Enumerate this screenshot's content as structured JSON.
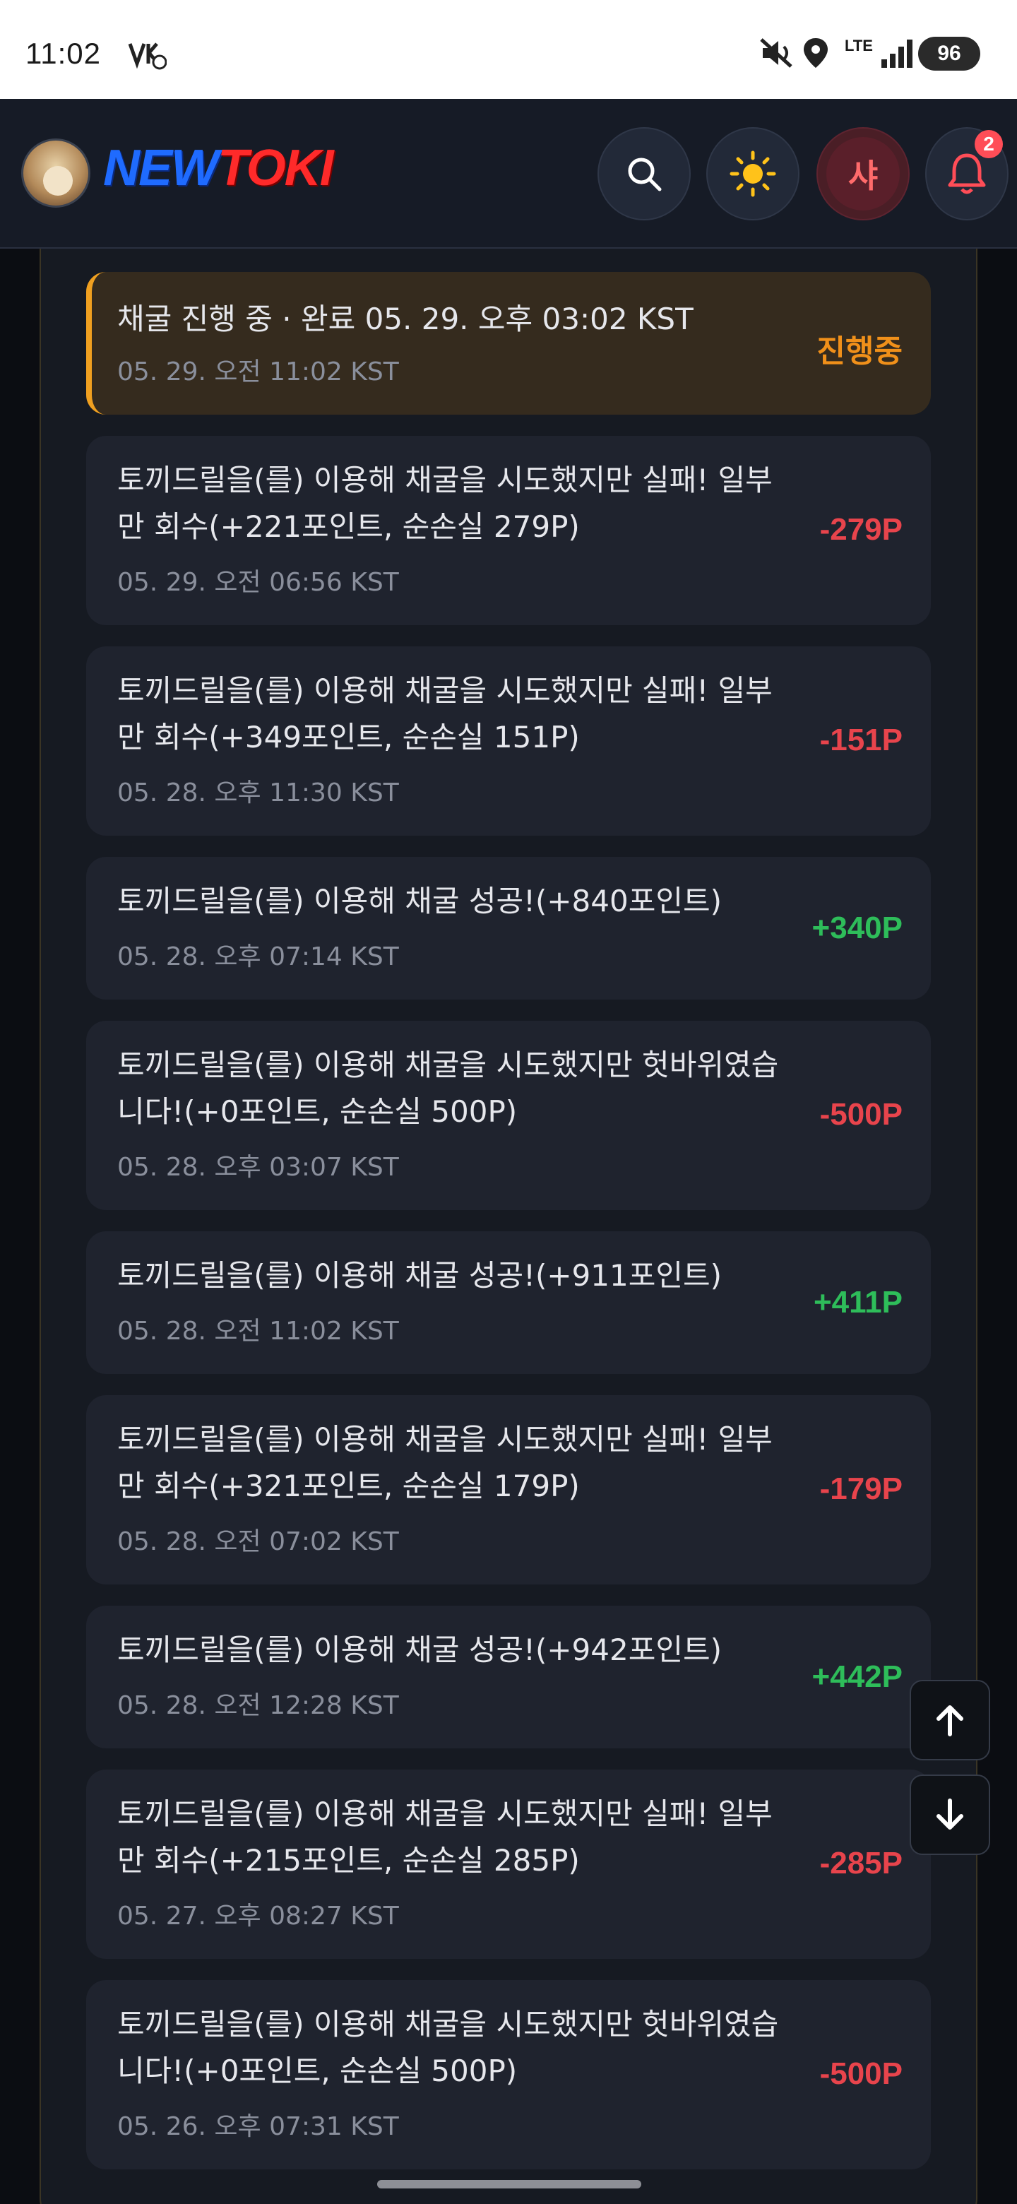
{
  "status_bar": {
    "time": "11:02",
    "network": "LTE",
    "battery": "96"
  },
  "header": {
    "logo_new": "NEW",
    "logo_toki": "TOKI",
    "user_initial": "샤",
    "notification_count": "2"
  },
  "entries": [
    {
      "message": "채굴 진행 중 · 완료 05. 29. 오후 03:02 KST",
      "date": "05. 29. 오전 11:02 KST",
      "amount": "진행중",
      "type": "pending"
    },
    {
      "message": "토끼드릴을(를) 이용해 채굴을 시도했지만 실패! 일부만 회수(+221포인트, 순손실 279P)",
      "date": "05. 29. 오전 06:56 KST",
      "amount": "-279P",
      "type": "negative"
    },
    {
      "message": "토끼드릴을(를) 이용해 채굴을 시도했지만 실패! 일부만 회수(+349포인트, 순손실 151P)",
      "date": "05. 28. 오후 11:30 KST",
      "amount": "-151P",
      "type": "negative"
    },
    {
      "message": "토끼드릴을(를) 이용해 채굴 성공!(+840포인트)",
      "date": "05. 28. 오후 07:14 KST",
      "amount": "+340P",
      "type": "positive"
    },
    {
      "message": "토끼드릴을(를) 이용해 채굴을 시도했지만 헛바위였습니다!(+0포인트, 순손실 500P)",
      "date": "05. 28. 오후 03:07 KST",
      "amount": "-500P",
      "type": "negative"
    },
    {
      "message": "토끼드릴을(를) 이용해 채굴 성공!(+911포인트)",
      "date": "05. 28. 오전 11:02 KST",
      "amount": "+411P",
      "type": "positive"
    },
    {
      "message": "토끼드릴을(를) 이용해 채굴을 시도했지만 실패! 일부만 회수(+321포인트, 순손실 179P)",
      "date": "05. 28. 오전 07:02 KST",
      "amount": "-179P",
      "type": "negative"
    },
    {
      "message": "토끼드릴을(를) 이용해 채굴 성공!(+942포인트)",
      "date": "05. 28. 오전 12:28 KST",
      "amount": "+442P",
      "type": "positive"
    },
    {
      "message": "토끼드릴을(를) 이용해 채굴을 시도했지만 실패! 일부만 회수(+215포인트, 순손실 285P)",
      "date": "05. 27. 오후 08:27 KST",
      "amount": "-285P",
      "type": "negative"
    },
    {
      "message": "토끼드릴을(를) 이용해 채굴을 시도했지만 헛바위였습니다!(+0포인트, 순손실 500P)",
      "date": "05. 26. 오후 07:31 KST",
      "amount": "-500P",
      "type": "negative"
    }
  ],
  "colors": {
    "negative": "#e8444c",
    "positive": "#2ebd5a",
    "pending": "#f0901a"
  }
}
